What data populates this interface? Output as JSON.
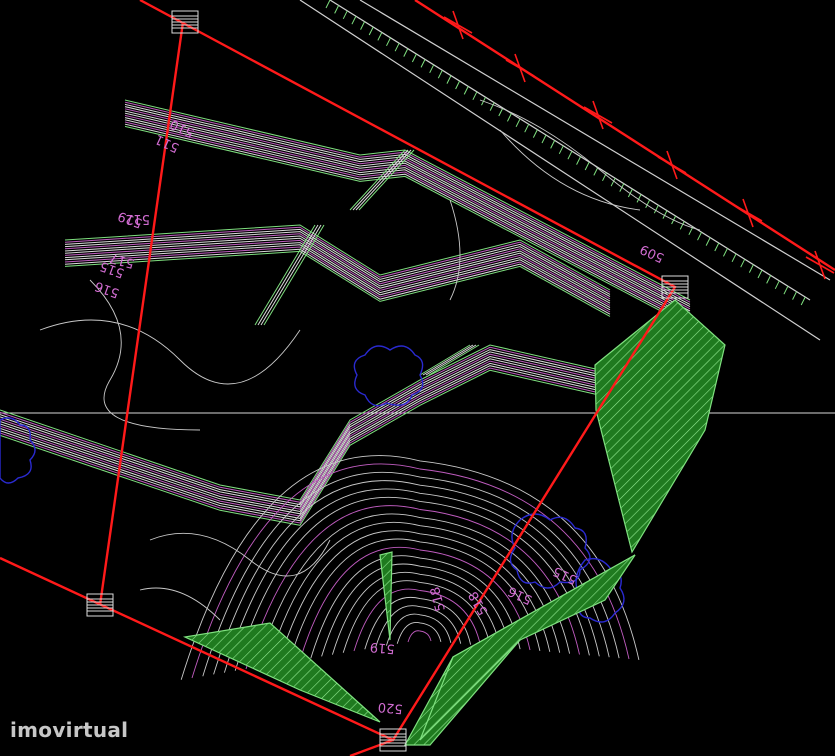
{
  "watermark": "imovirtual",
  "colors": {
    "background": "#000000",
    "boundary": "#ff1a1a",
    "contour": "#c9c9c9",
    "contour_highlight": "#c05cc0",
    "fill_green": "#1f7a1f",
    "hatch": "#7fe07f",
    "blue": "#2020c8"
  },
  "contour_labels": [
    "519",
    "515",
    "516",
    "517",
    "512",
    "510",
    "511",
    "509",
    "518",
    "518",
    "515",
    "516",
    "519",
    "520"
  ]
}
